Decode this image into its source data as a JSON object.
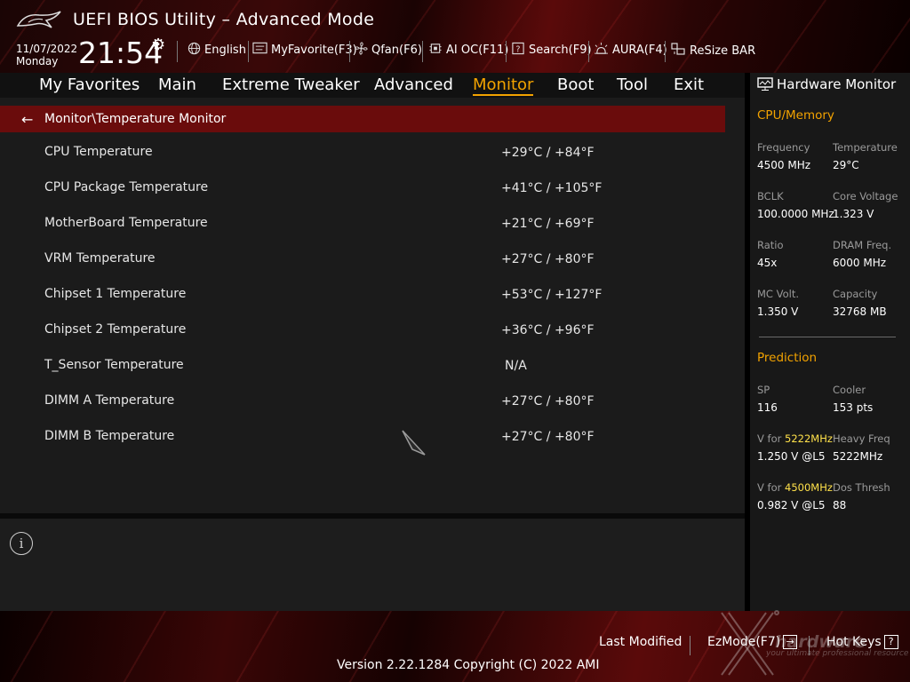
{
  "header": {
    "title": "UEFI BIOS Utility – Advanced Mode",
    "date": "11/07/2022",
    "day": "Monday",
    "time": "21:54",
    "toolbar": [
      {
        "icon": "globe-icon",
        "label": "English"
      },
      {
        "icon": "favorite-list-icon",
        "label": "MyFavorite(F3)"
      },
      {
        "icon": "fan-icon",
        "label": "Qfan(F6)"
      },
      {
        "icon": "ai-chip-icon",
        "label": "AI OC(F11)"
      },
      {
        "icon": "search-help-icon",
        "label": "Search(F9)"
      },
      {
        "icon": "aura-light-icon",
        "label": "AURA(F4)"
      },
      {
        "icon": "resize-bar-icon",
        "label": "ReSize BAR"
      }
    ]
  },
  "nav": {
    "tabs": [
      "My Favorites",
      "Main",
      "Extreme Tweaker",
      "Advanced",
      "Monitor",
      "Boot",
      "Tool",
      "Exit"
    ],
    "active": "Monitor"
  },
  "main": {
    "breadcrumb": "Monitor\\Temperature Monitor",
    "rows": [
      {
        "label": "CPU Temperature",
        "value": "+29°C / +84°F"
      },
      {
        "label": "CPU Package Temperature",
        "value": "+41°C / +105°F"
      },
      {
        "label": "MotherBoard Temperature",
        "value": "+21°C / +69°F"
      },
      {
        "label": "VRM Temperature",
        "value": "+27°C / +80°F"
      },
      {
        "label": "Chipset 1 Temperature",
        "value": "+53°C / +127°F"
      },
      {
        "label": "Chipset 2 Temperature",
        "value": "+36°C / +96°F"
      },
      {
        "label": "T_Sensor Temperature",
        "value": "N/A"
      },
      {
        "label": "DIMM A Temperature",
        "value": "+27°C / +80°F"
      },
      {
        "label": "DIMM B Temperature",
        "value": "+27°C / +80°F"
      }
    ]
  },
  "hw": {
    "title": "Hardware Monitor",
    "cpu_section": "CPU/Memory",
    "frequency_label": "Frequency",
    "frequency": "4500 MHz",
    "temperature_label": "Temperature",
    "temperature": "29°C",
    "bclk_label": "BCLK",
    "bclk": "100.0000 MHz",
    "core_voltage_label": "Core Voltage",
    "core_voltage": "1.323 V",
    "ratio_label": "Ratio",
    "ratio": "45x",
    "dram_freq_label": "DRAM Freq.",
    "dram_freq": "6000 MHz",
    "mc_volt_label": "MC Volt.",
    "mc_volt": "1.350 V",
    "capacity_label": "Capacity",
    "capacity": "32768 MB",
    "prediction_section": "Prediction",
    "sp_label": "SP",
    "sp": "116",
    "cooler_label": "Cooler",
    "cooler": "153 pts",
    "v_for_prefix": "V for ",
    "v1_freq": "5222MHz",
    "v1": "1.250 V @L5",
    "heavy_freq_label": "Heavy Freq",
    "heavy_freq": "5222MHz",
    "v2_freq": "4500MHz",
    "v2": "0.982 V @L5",
    "dos_thresh_label": "Dos Thresh",
    "dos_thresh": "88"
  },
  "footer": {
    "last_modified": "Last Modified",
    "ezmode": "EzMode(F7)",
    "ezmode_key": "→",
    "hot_keys": "Hot Keys",
    "hot_keys_key": "?",
    "version": "Version 2.22.1284 Copyright (C) 2022 AMI",
    "watermark": "hardware",
    "watermark_sub": "your ultimate professional resource"
  },
  "colors": {
    "accent": "#f2a200",
    "highlight": "#ffe14a",
    "breadcrumb_bg": "#6a0c0c"
  }
}
